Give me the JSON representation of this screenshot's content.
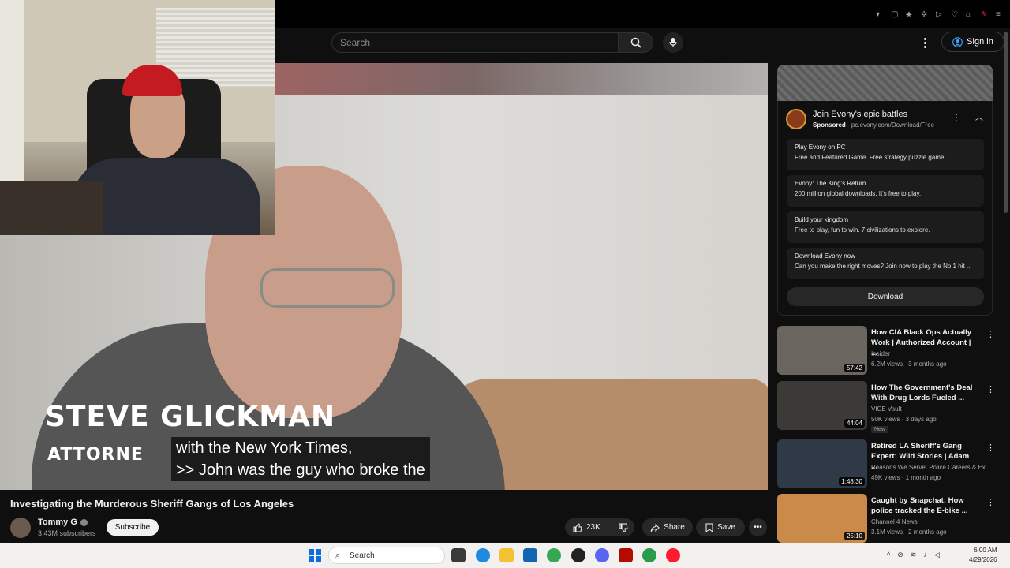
{
  "header": {
    "search_placeholder": "Search",
    "signin_label": "Sign in"
  },
  "video": {
    "lower_third_name": "STEVE GLICKMAN",
    "lower_third_role": "ATTORNE",
    "caption_line1": "with the New York Times,",
    "caption_line2": ">> John was the guy who broke the",
    "title": "Investigating the Murderous Sheriff Gangs of Los Angeles",
    "channel": "Tommy G",
    "subscribers": "3.43M subscribers",
    "subscribe_label": "Subscribe",
    "likes": "23K",
    "share_label": "Share",
    "save_label": "Save"
  },
  "ad": {
    "title": "Join Evony's epic battles",
    "sponsored": "Sponsored",
    "url": "pc.evony.com/Download/Free",
    "items": [
      {
        "heading": "Play Evony on PC",
        "desc": "Free and Featured Game. Free strategy puzzle game."
      },
      {
        "heading": "Evony: The King's Return",
        "desc": "200 million global downloads. It's free to play."
      },
      {
        "heading": "Build your kingdom",
        "desc": "Free to play, fun to win. 7 civilizations to explore."
      },
      {
        "heading": "Download Evony now",
        "desc": "Can you make the right moves? Join now to play the No.1 hit ..."
      }
    ],
    "download_label": "Download"
  },
  "recommended": [
    {
      "title": "How CIA Black Ops Actually Work | Authorized Account | ...",
      "channel": "Insider",
      "meta": "6.2M views · 3 months ago",
      "duration": "57:42",
      "badge": "",
      "thumb_color": "#6b6560"
    },
    {
      "title": "How The Government's Deal With Drug Lords Fueled ...",
      "channel": "VICE Vault",
      "meta": "50K views · 3 days ago",
      "duration": "44:04",
      "badge": "New",
      "thumb_color": "#3c3a36"
    },
    {
      "title": "Retired LA Sheriff's Gang Expert: Wild Stories | Adam ...",
      "channel": "Reasons We Serve: Police Careers & Exp...",
      "meta": "49K views · 1 month ago",
      "duration": "1:48:30",
      "badge": "",
      "thumb_color": "#2f3948"
    },
    {
      "title": "Caught by Snapchat: How police tracked the E-bike ...",
      "channel": "Channel 4 News",
      "meta": "3.1M views · 2 months ago",
      "duration": "25:10",
      "badge": "",
      "thumb_color": "#c98a4a"
    }
  ],
  "taskbar": {
    "search_label": "Search",
    "time": "6:00 AM",
    "date": "4/29/2026"
  }
}
